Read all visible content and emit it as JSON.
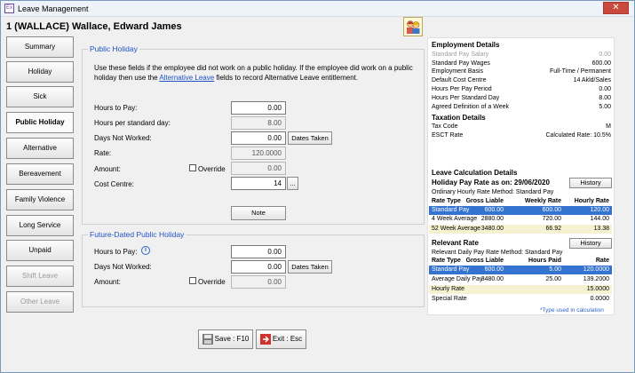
{
  "window": {
    "title": "Leave Management",
    "close_glyph": "✕"
  },
  "header": {
    "employee": "1 (WALLACE) Wallace, Edward James"
  },
  "nav": [
    {
      "label": "Summary"
    },
    {
      "label": "Holiday"
    },
    {
      "label": "Sick"
    },
    {
      "label": "Public Holiday"
    },
    {
      "label": "Alternative"
    },
    {
      "label": "Bereavement"
    },
    {
      "label": "Family Violence"
    },
    {
      "label": "Long Service"
    },
    {
      "label": "Unpaid"
    },
    {
      "label": "Shift Leave"
    },
    {
      "label": "Other Leave"
    }
  ],
  "public_holiday": {
    "legend": "Public Holiday",
    "info_part1": "Use these fields if the employee did not work on a public holiday. If the employee did work on a public holiday then use the ",
    "info_link": "Alternative Leave",
    "info_part2": " fields to record Alternative Leave entitlement.",
    "hours_to_pay_label": "Hours to Pay:",
    "hours_to_pay": "0.00",
    "hours_per_day_label": "Hours per standard day:",
    "hours_per_day": "8.00",
    "days_not_worked_label": "Days Not Worked:",
    "days_not_worked": "0.00",
    "dates_taken": "Dates Taken",
    "rate_label": "Rate:",
    "rate": "120.0000",
    "amount_label": "Amount:",
    "override_label": "Override",
    "amount": "0.00",
    "cost_centre_label": "Cost Centre:",
    "cost_centre": "14",
    "ellipsis": "...",
    "note_btn": "Note"
  },
  "future": {
    "legend": "Future-Dated Public Holiday",
    "hours_to_pay_label": "Hours to Pay:",
    "info_glyph": "i",
    "hours_to_pay": "0.00",
    "days_not_worked_label": "Days Not Worked:",
    "days_not_worked": "0.00",
    "dates_taken": "Dates Taken",
    "amount_label": "Amount:",
    "override_label": "Override",
    "amount": "0.00"
  },
  "footer": {
    "save": "Save : F10",
    "exit": "Exit : Esc"
  },
  "employment": {
    "heading": "Employment Details",
    "rows": [
      {
        "k": "Standard Pay Salary",
        "v": "0.00"
      },
      {
        "k": "Standard Pay Wages",
        "v": "600.00"
      },
      {
        "k": "Employment Basis",
        "v": "Full-Time / Permanent"
      },
      {
        "k": "Default Cost Centre",
        "v": "14 Akld/Sales"
      },
      {
        "k": "Hours Per Pay Period",
        "v": "0.00"
      },
      {
        "k": "Hours Per Standard Day",
        "v": "8.00"
      },
      {
        "k": "Agreed Definition of a Week",
        "v": "5.00"
      }
    ]
  },
  "taxation": {
    "heading": "Taxation Details",
    "rows": [
      {
        "k": "Tax Code",
        "v": "M"
      },
      {
        "k": "ESCT Rate",
        "v": "Calculated Rate: 10.5%"
      }
    ]
  },
  "leave_calc": {
    "heading": "Leave Calculation Details",
    "holiday_pay_heading": "Holiday Pay Rate as on: 29/06/2020",
    "history": "History",
    "ordinary_method": "Ordinary Hourly Rate Method:   Standard Pay",
    "headers": [
      "Rate Type",
      "Gross Liable",
      "Weekly Rate",
      "Hourly Rate"
    ],
    "rows": [
      [
        "Standard Pay",
        "600.00",
        "600.00",
        "120.00"
      ],
      [
        "4 Week Average",
        "2880.00",
        "720.00",
        "144.00"
      ],
      [
        "52 Week Average",
        "3480.00",
        "66.92",
        "13.38"
      ]
    ],
    "relevant_heading": "Relevant Rate",
    "relevant_method": "Relevant Daily Pay Rate Method:   Standard Pay",
    "rel_headers": [
      "Rate Type",
      "Gross Liable",
      "Hours Paid",
      "Rate"
    ],
    "rel_rows": [
      [
        "Standard Pay",
        "600.00",
        "5.00",
        "120.0000"
      ],
      [
        "Average Daily Pay",
        "3480.00",
        "25.00",
        "139.2000"
      ]
    ],
    "extra_rows": [
      {
        "k": "Hourly Rate",
        "v": "15.0000"
      },
      {
        "k": "Special Rate",
        "v": "0.0000"
      }
    ],
    "note": "*Type used in calculation"
  }
}
